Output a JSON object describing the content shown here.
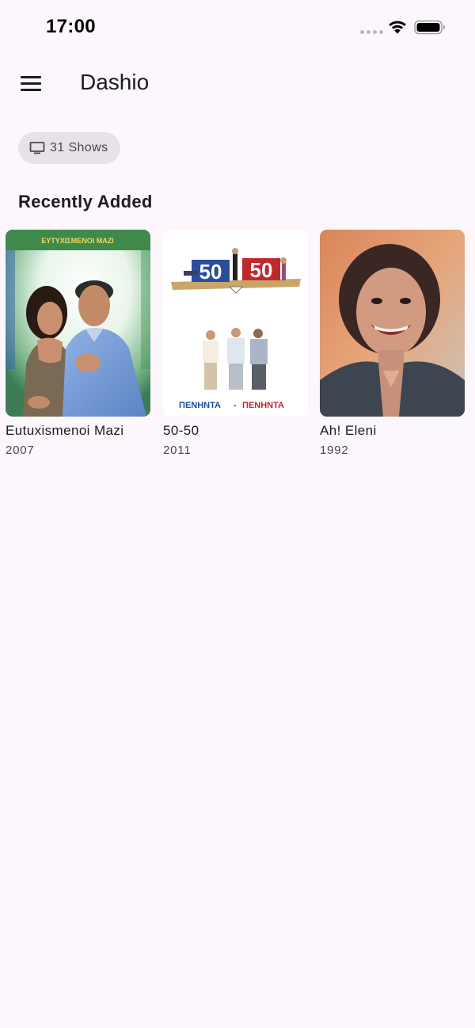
{
  "status_bar": {
    "time": "17:00"
  },
  "app_bar": {
    "title": "Dashio",
    "menu_icon": "hamburger-menu-icon"
  },
  "chip": {
    "icon": "tv-icon",
    "label": "31 Shows"
  },
  "section": {
    "title": "Recently Added"
  },
  "shows": [
    {
      "title": "Eutuxismenoi Mazi",
      "year": "2007",
      "poster_logo": "ΕΥΤΥΧΙΣΜΕΝΟΙ ΜΑΖΙ"
    },
    {
      "title": "50-50",
      "year": "2011",
      "poster_logo_left": "50",
      "poster_logo_right": "50",
      "poster_caption_left": "ΠΕΝΗΝΤΑ",
      "poster_caption_sep": "-",
      "poster_caption_right": "ΠΕΝΗΝΤΑ"
    },
    {
      "title": "Ah! Eleni",
      "year": "1992"
    }
  ],
  "colors": {
    "background": "#fdf6fd",
    "chip_background": "#e8e1e8",
    "text_primary": "#1c1b1f",
    "text_secondary": "#49454f"
  }
}
